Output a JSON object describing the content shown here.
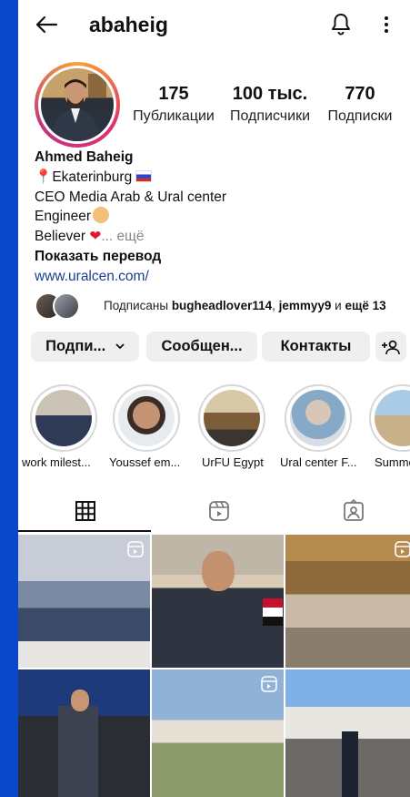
{
  "header": {
    "username": "abaheig"
  },
  "profile": {
    "stats": [
      {
        "value": "175",
        "label": "Публикации"
      },
      {
        "value": "100 тыс.",
        "label": "Подписчики"
      },
      {
        "value": "770",
        "label": "Подписки"
      }
    ],
    "name": "Ahmed Baheig",
    "location": "Ekaterinburg",
    "line2": "CEO Media Arab & Ural center",
    "line3": "Engineer",
    "line4": "Believer",
    "more": "... ещё",
    "translate": "Показать перевод",
    "link": "www.uralcen.com/"
  },
  "followed_by": {
    "prefix": "Подписаны ",
    "user1": "bugheadlover114",
    "sep": ", ",
    "user2": "jemmyy9",
    "and": " и ",
    "rest": "ещё 13"
  },
  "buttons": {
    "follow": "Подпи...",
    "message": "Сообщен...",
    "contacts": "Контакты"
  },
  "highlights": [
    {
      "label": "work milest..."
    },
    {
      "label": "Youssef em..."
    },
    {
      "label": "UrFU Egypt"
    },
    {
      "label": "Ural center F..."
    },
    {
      "label": "Summe"
    }
  ],
  "colors": {
    "accent": "#0b48c9",
    "link": "#1a3e8c",
    "button": "#efefef"
  }
}
